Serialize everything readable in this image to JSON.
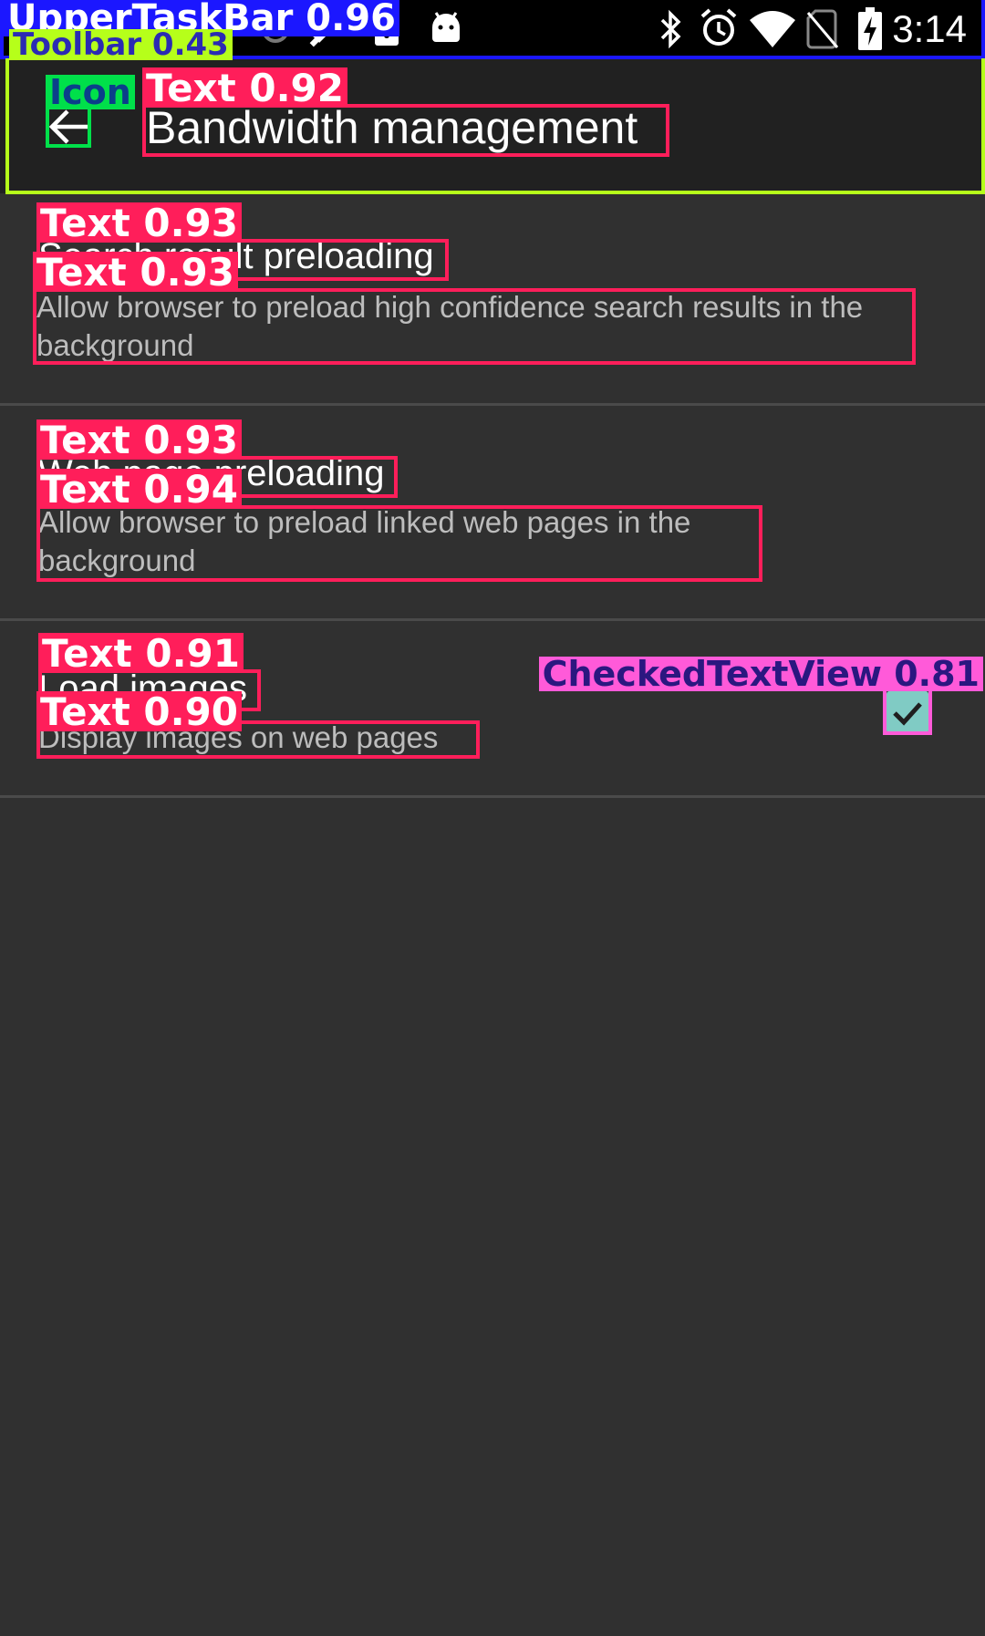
{
  "status_bar": {
    "time": "3:14",
    "left_icons": [
      "sync-icon",
      "satellite-icon",
      "lock-icon",
      "android-icon"
    ],
    "right_icons": [
      "bluetooth-icon",
      "alarm-icon",
      "wifi-icon",
      "no-sim-icon",
      "battery-charging-icon"
    ]
  },
  "toolbar": {
    "back_icon": "arrow-back-icon",
    "title": "Bandwidth management"
  },
  "preferences": [
    {
      "title": "Search result preloading",
      "summary": "Allow browser to preload high confidence search results in the background"
    },
    {
      "title": "Web page preloading",
      "summary": "Allow browser to preload linked web pages in the background"
    },
    {
      "title": "Load images",
      "summary": "Display images on web pages",
      "checked": true
    }
  ],
  "annotations": {
    "upper_task_bar": "UpperTaskBar 0.96",
    "toolbar": "Toolbar 0.43",
    "icon": "Icon",
    "title_text": "Text 0.92",
    "pref1_title": "Text 0.93",
    "pref1_summary": "Text 0.93",
    "pref2_title": "Text 0.93",
    "pref2_summary": "Text 0.94",
    "pref3_title": "Text 0.91",
    "pref3_summary": "Text 0.90",
    "checked_text_view": "CheckedTextView 0.81"
  },
  "colors": {
    "background": "#303030",
    "toolbar": "#212121",
    "status_bar": "#000000",
    "accent": "#80cbc4",
    "text_box": "#ff1e5a",
    "icon_box": "#00e04a",
    "toolbar_box": "#b6ff1a",
    "taskbar_box": "#1b17ff",
    "check_box": "#ff5ad9"
  }
}
